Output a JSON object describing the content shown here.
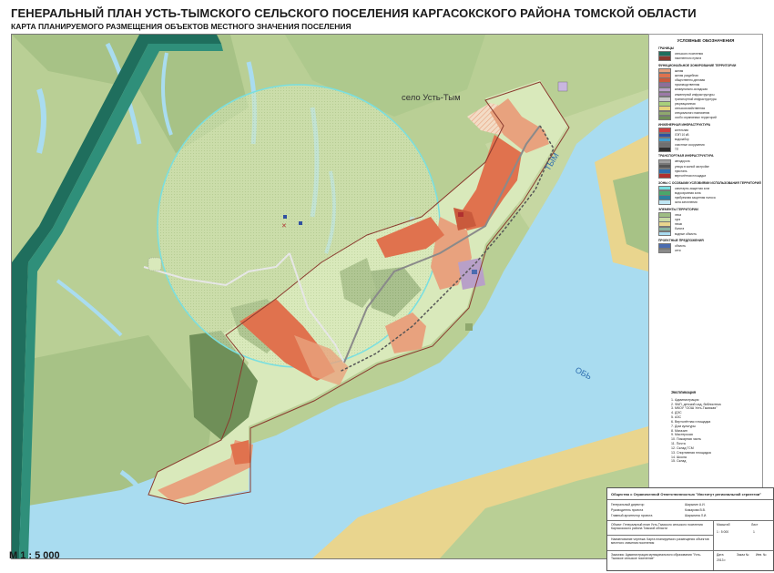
{
  "header": {
    "title": "ГЕНЕРАЛЬНЫЙ ПЛАН УСТЬ-ТЫМСКОГО СЕЛЬСКОГО ПОСЕЛЕНИЯ КАРГАСОКСКОГО РАЙОНА ТОМСКОЙ ОБЛАСТИ",
    "subtitle": "КАРТА ПЛАНИРУЕМОГО РАЗМЕЩЕНИЯ ОБЪЕКТОВ МЕСТНОГО ЗНАЧЕНИЯ ПОСЕЛЕНИЯ"
  },
  "map": {
    "village_label": "село Усть-Тым",
    "river_tym": "ТЫМ",
    "river_ob": "ОБЬ",
    "scale": "М 1 : 5 000",
    "colors": {
      "forest": "#9fbd84",
      "forest_dark": "#6f8f58",
      "meadow": "#c8dba5",
      "water": "#a9dcf0",
      "sand": "#e9d58e",
      "residential": "#e8a27e",
      "residential_dense": "#e0724e",
      "boundary_green": "#1f6e5d",
      "zone_circle": "#79dfe0",
      "settlement_zone": "#d9e9bb"
    }
  },
  "legend": {
    "title": "УСЛОВНЫЕ ОБОЗНАЧЕНИЯ",
    "sections": [
      {
        "heading": "ГРАНИЦЫ",
        "items": [
          {
            "label": "сельского поселения",
            "color": "#1f6e5d"
          },
          {
            "label": "населенного пункта",
            "color": "#8a3a2e"
          }
        ]
      },
      {
        "heading": "ФУНКЦИОНАЛЬНОЕ ЗОНИРОВАНИЕ ТЕРРИТОРИИ",
        "items": [
          {
            "label": "жилая",
            "color": "#e8a27e"
          },
          {
            "label": "жилая усадебная",
            "color": "#e0724e"
          },
          {
            "label": "общественно-деловая",
            "color": "#c95a3c"
          },
          {
            "label": "производственная",
            "color": "#8d6e9a"
          },
          {
            "label": "коммунально-складская",
            "color": "#b8a0c8"
          },
          {
            "label": "инженерной инфраструктуры",
            "color": "#9c7aa8"
          },
          {
            "label": "транспортной инфраструктуры",
            "color": "#c8c8c8"
          },
          {
            "label": "рекреационная",
            "color": "#a8cf7a"
          },
          {
            "label": "сельскохозяйственная",
            "color": "#e6d27a"
          },
          {
            "label": "специального назначения",
            "color": "#8fa86e"
          },
          {
            "label": "особо охраняемых территорий",
            "color": "#6f8f58"
          }
        ]
      },
      {
        "heading": "ИНЖЕНЕРНАЯ ИНФРАСТРУКТУРА",
        "items": [
          {
            "label": "котельная",
            "color": "#d04040"
          },
          {
            "label": "ЛЭП 10 кВ",
            "color": "#3050a0"
          },
          {
            "label": "водозабор",
            "color": "#40a0d0"
          },
          {
            "label": "очистные сооружения",
            "color": "#707070"
          },
          {
            "label": "ТП",
            "color": "#303030"
          }
        ]
      },
      {
        "heading": "ТРАНСПОРТНАЯ ИНФРАСТРУКТУРА",
        "items": [
          {
            "label": "автодорога",
            "color": "#a0a0a0"
          },
          {
            "label": "улицы в жилой застройке",
            "color": "#555555"
          },
          {
            "label": "пристань",
            "color": "#2f6fb0"
          },
          {
            "label": "вертолётная площадка",
            "color": "#b03030"
          }
        ]
      },
      {
        "heading": "ЗОНЫ С ОСОБЫМИ УСЛОВИЯМИ ИСПОЛЬЗОВАНИЯ ТЕРРИТОРИЙ",
        "items": [
          {
            "label": "санитарно-защитная зона",
            "color": "#79dfe0"
          },
          {
            "label": "водоохранная зона",
            "color": "#4aa66a"
          },
          {
            "label": "прибрежная защитная полоса",
            "color": "#2d7f9e"
          },
          {
            "label": "зона затопления",
            "color": "#bfe6f4"
          }
        ]
      },
      {
        "heading": "ЭЛЕМЕНТЫ ТЕРРИТОРИИ",
        "items": [
          {
            "label": "леса",
            "color": "#9fbd84"
          },
          {
            "label": "луга",
            "color": "#c8dba5"
          },
          {
            "label": "пески",
            "color": "#e9d58e"
          },
          {
            "label": "болота",
            "color": "#86b3a0"
          },
          {
            "label": "водные объекты",
            "color": "#a9dcf0"
          }
        ]
      },
      {
        "heading": "ПРОЕКТНЫЕ ПРЕДЛОЖЕНИЯ",
        "items": [
          {
            "label": "объекты",
            "color": "#4a6bb0"
          },
          {
            "label": "сети",
            "color": "#8a8a8a"
          }
        ]
      }
    ]
  },
  "explication": {
    "title": "Экспликация",
    "items": [
      "1. Администрация",
      "2. ФАП, детский сад, библиотека",
      "3. МКОУ \"ООШ Усть-Тымская\"",
      "4. ДЭС",
      "5. АЗС",
      "6. Вертолётная площадка",
      "7. Дом культуры",
      "8. Магазин",
      "9. Мастерская",
      "10. Пожарная часть",
      "11. Почта",
      "12. Склад ГСМ",
      "13. Спортивная площадка",
      "14. Школа",
      "15. Склад"
    ]
  },
  "stamp": {
    "org": "Общество с Ограниченной Ответственностью \"Институт региональной стратегии\"",
    "rows": [
      {
        "role": "Генеральный директор",
        "name": "Шарыпин А.И."
      },
      {
        "role": "Руководитель проекта",
        "name": "Комарова В.В."
      },
      {
        "role": "Главный архитектор проекта",
        "name": "Шарыпина Л.И."
      }
    ],
    "object": "Объект: Генеральный план Усть-Тымского сельского поселения Каргасокского района Томской области",
    "drawing": "Наименование чертежа: Карта планируемого размещения объектов местного значения поселения",
    "customer": "Заказчик: Администрация муниципального образования \"Усть-Тымское сельское поселение\"",
    "scale_label": "Масштаб",
    "scale_value": "1 : 5 000",
    "sheet_label": "Лист",
    "sheet_value": "1",
    "date_label": "Дата",
    "date_value": "2013 г.",
    "order_label": "Заказ №",
    "inv_label": "Инв. №"
  }
}
